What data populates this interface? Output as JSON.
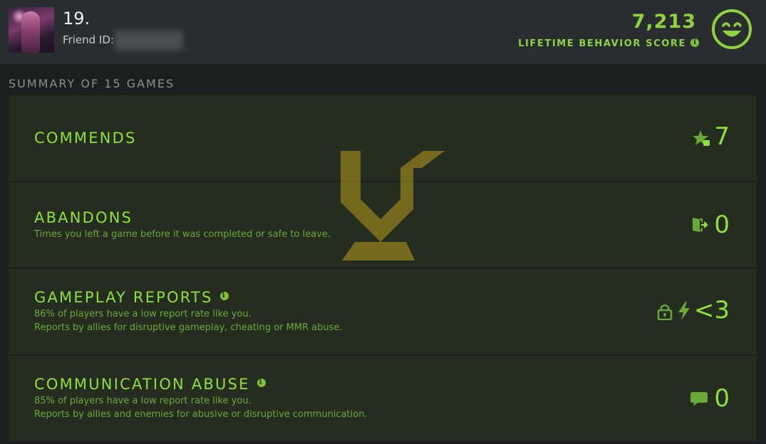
{
  "header": {
    "player_name": "19.",
    "friend_id_label": "Friend ID:",
    "score_value": "7,213",
    "score_label": "LIFETIME BEHAVIOR SCORE",
    "score_info_icon": "info-icon",
    "mood_icon": "smiley-face-icon"
  },
  "summary": {
    "title": "SUMMARY OF 15 GAMES"
  },
  "rows": [
    {
      "title": "COMMENDS",
      "value": "7",
      "icon": "star-thumbs-up-icon"
    },
    {
      "title": "ABANDONS",
      "desc": "Times you left a game before it was completed or safe to leave.",
      "value": "0",
      "icon": "exit-door-icon"
    },
    {
      "title": "GAMEPLAY REPORTS",
      "desc1": "86% of players have a low report rate like you.",
      "desc2": "Reports by allies for disruptive gameplay, cheating or MMR abuse.",
      "value": "<3",
      "icons": [
        "lock-icon",
        "lightning-icon"
      ]
    },
    {
      "title": "COMMUNICATION ABUSE",
      "desc1": "85% of players have a low report rate like you.",
      "desc2": "Reports by allies and enemies for abusive or disruptive communication.",
      "value": "0",
      "icon": "chat-bubble-icon"
    }
  ],
  "colors": {
    "accent_green": "#8fe03a",
    "row_bg": "#252d20",
    "emblem_gold": "#b59b1a"
  }
}
